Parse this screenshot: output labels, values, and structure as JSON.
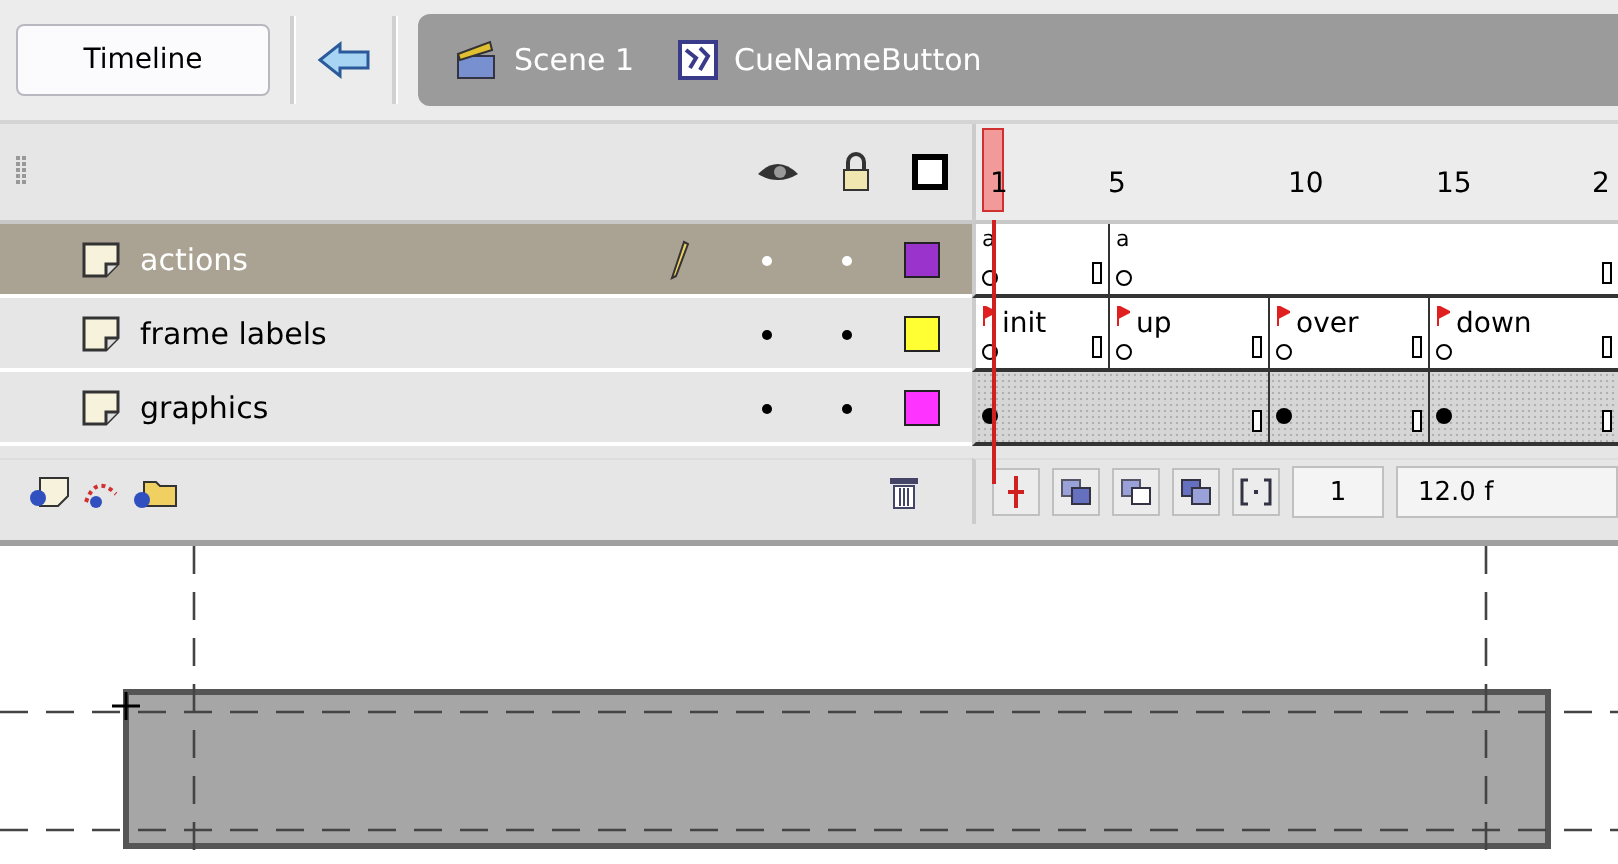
{
  "timeline_button": "Timeline",
  "breadcrumb": [
    {
      "kind": "scene",
      "label": "Scene 1"
    },
    {
      "kind": "symbol",
      "label": "CueNameButton"
    }
  ],
  "ruler": [
    "1",
    "5",
    "10",
    "15",
    "2"
  ],
  "layers": [
    {
      "name": "actions",
      "selected": true,
      "editing": true,
      "color": "#9933cc",
      "frames": [
        {
          "kind": "action",
          "mark": "a"
        },
        {
          "kind": "action",
          "mark": "a"
        }
      ]
    },
    {
      "name": "frame labels",
      "selected": false,
      "editing": false,
      "color": "#ffff33",
      "frames": [
        {
          "kind": "label",
          "label": "init"
        },
        {
          "kind": "label",
          "label": "up"
        },
        {
          "kind": "label",
          "label": "over"
        },
        {
          "kind": "label",
          "label": "down"
        }
      ]
    },
    {
      "name": "graphics",
      "selected": false,
      "editing": false,
      "color": "#ff33ff",
      "frames": [
        {
          "kind": "filled"
        },
        {
          "kind": "filled"
        },
        {
          "kind": "filled"
        }
      ]
    }
  ],
  "current_frame": "1",
  "frame_rate": "12.0 f"
}
